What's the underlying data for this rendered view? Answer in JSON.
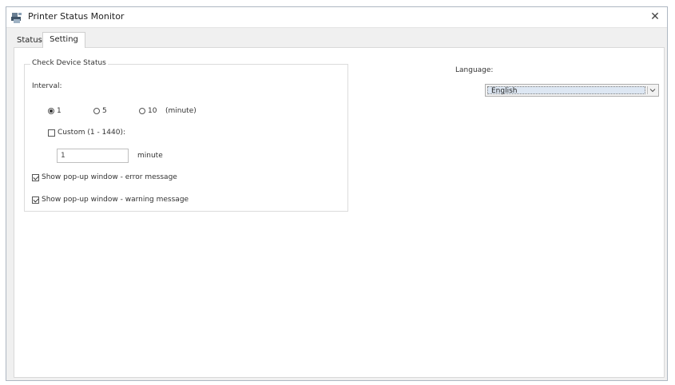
{
  "window": {
    "title": "Printer Status Monitor",
    "close_glyph": "✕"
  },
  "tabs": [
    {
      "label": "Status",
      "active": false
    },
    {
      "label": "Setting",
      "active": true
    }
  ],
  "check_device": {
    "group_title": "Check Device Status",
    "interval_label": "Interval:",
    "options": [
      {
        "label": "1",
        "checked": true
      },
      {
        "label": "5",
        "checked": false
      },
      {
        "label": "10",
        "checked": false
      }
    ],
    "unit_label": "(minute)",
    "custom_label": "Custom (1 - 1440):",
    "custom_checked": false,
    "custom_value": "1",
    "custom_unit": "minute",
    "show_error_label": "Show pop-up window - error message",
    "show_error_checked": true,
    "show_warning_label": "Show pop-up window - warning message",
    "show_warning_checked": true
  },
  "language": {
    "label": "Language:",
    "selected": "English"
  },
  "icons": {
    "app": "printer-icon",
    "close": "close-icon",
    "dropdown": "chevron-down-icon"
  },
  "colors": {
    "window_border": "#aeb7c2",
    "selection": "#dde7f3"
  }
}
